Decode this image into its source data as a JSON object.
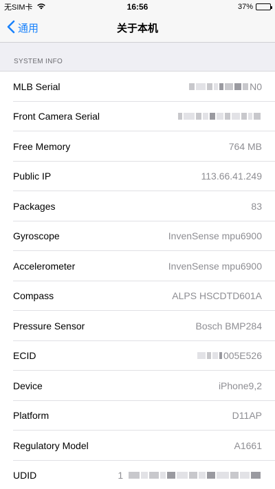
{
  "status_bar": {
    "carrier": "无SIM卡",
    "time": "16:56",
    "battery": "37%",
    "battery_level": 0.37
  },
  "nav": {
    "back_label": "通用",
    "title": "关于本机"
  },
  "section": {
    "header": "SYSTEM INFO"
  },
  "rows": [
    {
      "label": "MLB Serial",
      "value": "N0"
    },
    {
      "label": "Front Camera Serial",
      "value": ""
    },
    {
      "label": "Free Memory",
      "value": "764 MB"
    },
    {
      "label": "Public IP",
      "value": "113.66.41.249"
    },
    {
      "label": "Packages",
      "value": "83"
    },
    {
      "label": "Gyroscope",
      "value": "InvenSense mpu6900"
    },
    {
      "label": "Accelerometer",
      "value": "InvenSense mpu6900"
    },
    {
      "label": "Compass",
      "value": "ALPS HSCDTD601A"
    },
    {
      "label": "Pressure Sensor",
      "value": "Bosch BMP284"
    },
    {
      "label": "ECID",
      "value": "005E526"
    },
    {
      "label": "Device",
      "value": "iPhone9,2"
    },
    {
      "label": "Platform",
      "value": "D11AP"
    },
    {
      "label": "Regulatory Model",
      "value": "A1661"
    },
    {
      "label": "UDID",
      "value": "1"
    }
  ]
}
